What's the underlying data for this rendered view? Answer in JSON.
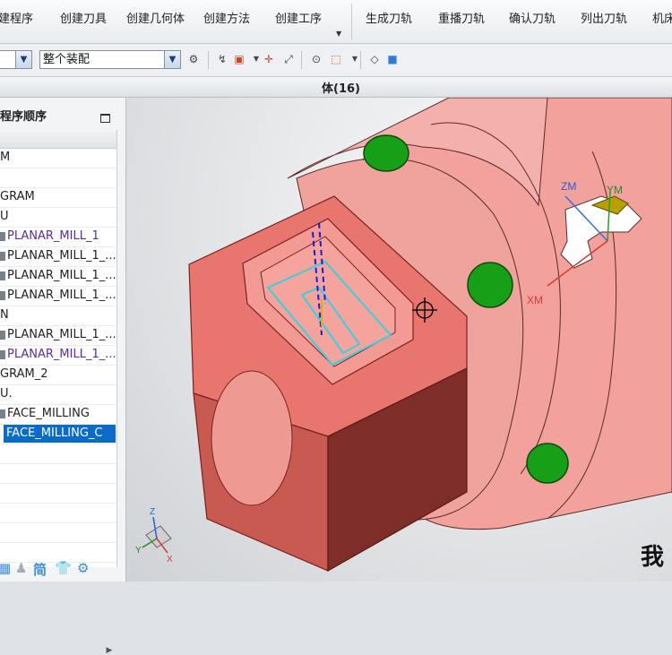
{
  "ribbon": {
    "items": [
      "建程序",
      "创建刀具",
      "创建几何体",
      "创建方法",
      "创建工序",
      "生成刀轨",
      "重播刀轨",
      "确认刀轨",
      "列出刀轨",
      "机床"
    ]
  },
  "toolbar": {
    "filter_combo": "",
    "assembly_combo": "整个装配"
  },
  "viewport_title": "体(16)",
  "navigator": {
    "title": "程序顺序",
    "rows": [
      {
        "text": "M",
        "type": "node"
      },
      {
        "text": "",
        "type": "blank"
      },
      {
        "text": "GRAM",
        "type": "node"
      },
      {
        "text": "U",
        "type": "node"
      },
      {
        "text": "PLANAR_MILL_1",
        "type": "op"
      },
      {
        "text": "PLANAR_MILL_1_...",
        "type": "op-dark"
      },
      {
        "text": "PLANAR_MILL_1_...",
        "type": "op-dark"
      },
      {
        "text": "PLANAR_MILL_1_...",
        "type": "op-dark"
      },
      {
        "text": "N",
        "type": "node"
      },
      {
        "text": "PLANAR_MILL_1_...",
        "type": "op-dark"
      },
      {
        "text": "PLANAR_MILL_1_...",
        "type": "op"
      },
      {
        "text": "GRAM_2",
        "type": "node"
      },
      {
        "text": "U.",
        "type": "node"
      },
      {
        "text": "FACE_MILLING",
        "type": "op-dark"
      },
      {
        "text": "FACE_MILLING_C",
        "type": "selected"
      }
    ]
  },
  "axes": {
    "zm": "ZM",
    "ym": "YM",
    "xm": "XM",
    "triad_z": "Z",
    "triad_y": "Y",
    "triad_x": "X"
  },
  "footer_icons": [
    "grid-icon",
    "person-icon",
    "简",
    "shirt-icon",
    "gear-icon"
  ],
  "footer_text": {
    "jian": "简"
  },
  "watermark": {
    "text": "我"
  },
  "colors": {
    "selection": "#0a6cc8",
    "part": "#f0908a",
    "hole": "#1aa51a",
    "op_purple": "#5b2aa8"
  }
}
